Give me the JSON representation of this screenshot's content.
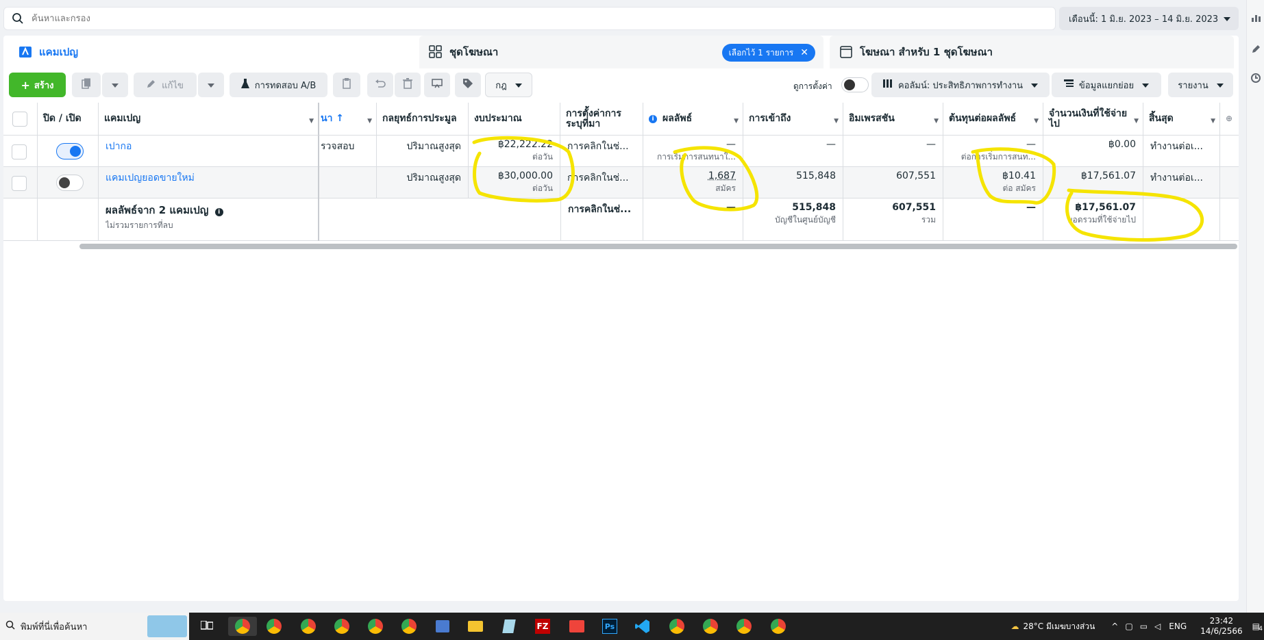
{
  "search": {
    "placeholder": "ค้นหาและกรอง"
  },
  "date_range": {
    "label": "เดือนนี้: 1 มิ.ย. 2023 – 14 มิ.ย. 2023"
  },
  "tabs": [
    {
      "label": "แคมเปญ"
    },
    {
      "label": "ชุดโฆษณา",
      "pill": "เลือกไว้ 1 รายการ"
    },
    {
      "label": "โฆษณา สำหรับ 1 ชุดโฆษณา"
    }
  ],
  "toolbar": {
    "create": "สร้าง",
    "edit": "แก้ไข",
    "ab_test": "การทดสอบ A/B",
    "rules": "กฎ",
    "view_settings": "ดูการตั้งค่า",
    "columns": "คอลัมน์: ประสิทธิภาพการทำงาน",
    "breakdown": "ข้อมูลแยกย่อย",
    "reports": "รายงาน"
  },
  "columns": {
    "toggle": "ปิด / เปิด",
    "campaign": "แคมเปญ",
    "delivery": "นา ↑",
    "bid_strategy": "กลยุทธ์การประมูล",
    "budget": "งบประมาณ",
    "attribution": "การตั้งค่าการระบุที่มา",
    "results": "ผลลัพธ์",
    "reach": "การเข้าถึง",
    "impressions": "อิมเพรสชัน",
    "cost_per_result": "ต้นทุนต่อผลลัพธ์",
    "amount_spent": "จำนวนเงินที่ใช้จ่ายไป",
    "ends": "สิ้นสุด"
  },
  "rows": [
    {
      "toggle_on": true,
      "campaign": "เปากอ",
      "delivery": "รวจสอบ",
      "bid_strategy": "ปริมาณสูงสุด",
      "budget": "฿22,222.22",
      "budget_sub": "ต่อวัน",
      "attribution": "การคลิกในช่...",
      "results": "—",
      "results_sub": "การเริ่มการสนทนาใ...",
      "reach": "—",
      "impressions": "—",
      "cost_per_result": "—",
      "cost_sub": "ต่อการเริ่มการสนท...",
      "amount_spent": "฿0.00",
      "ends": "ทำงานต่อเ..."
    },
    {
      "toggle_on": false,
      "campaign": "แคมเปญยอดขายใหม่",
      "delivery": "",
      "bid_strategy": "ปริมาณสูงสุด",
      "budget": "฿30,000.00",
      "budget_sub": "ต่อวัน",
      "attribution": "การคลิกในช่...",
      "results": "1,687",
      "results_sub": "สมัคร",
      "reach": "515,848",
      "impressions": "607,551",
      "cost_per_result": "฿10.41",
      "cost_sub": "ต่อ สมัคร",
      "amount_spent": "฿17,561.07",
      "ends": "ทำงานต่อเ..."
    }
  ],
  "summary": {
    "title": "ผลลัพธ์จาก 2 แคมเปญ",
    "sub": "ไม่รวมรายการที่ลบ",
    "attribution": "การคลิกในช่...",
    "results": "—",
    "reach": "515,848",
    "reach_sub": "บัญชีในศูนย์บัญชี",
    "impressions": "607,551",
    "impressions_sub": "รวม",
    "cost": "—",
    "amount_spent": "฿17,561.07",
    "amount_sub": "ยอดรวมที่ใช้จ่ายไป"
  },
  "taskbar": {
    "search_placeholder": "พิมพ์ที่นี่เพื่อค้นหา",
    "weather": "28°C มีเมฆบางส่วน",
    "lang": "ENG",
    "time": "23:42",
    "date": "14/6/2566",
    "notif_count": "4"
  },
  "colors": {
    "accent": "#1877f2",
    "create_green": "#42b72a",
    "highlight_yellow": "#f5e400"
  }
}
